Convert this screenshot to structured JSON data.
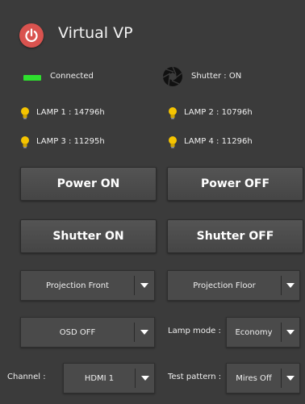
{
  "header": {
    "title": "Virtual VP"
  },
  "status": {
    "connection": "Connected",
    "shutter": "Shutter : ON",
    "led_color": "#2ee02e"
  },
  "lamps": [
    "LAMP 1 : 14796h",
    "LAMP 2 : 10796h",
    "LAMP 3 : 11295h",
    "LAMP 4 : 11296h"
  ],
  "buttons": {
    "power_on": "Power ON",
    "power_off": "Power OFF",
    "shutter_on": "Shutter ON",
    "shutter_off": "Shutter OFF"
  },
  "dropdowns": {
    "projection_mode": "Projection Front",
    "projection_orientation": "Projection Floor",
    "osd": "OSD OFF",
    "lamp_mode_label": "Lamp mode :",
    "lamp_mode": "Economy",
    "channel_label": "Channel :",
    "channel": "HDMI 1",
    "test_pattern_label": "Test pattern :",
    "test_pattern": "Mires Off"
  },
  "colors": {
    "background": "#3b3b3b",
    "power_icon_bg": "#d9534f",
    "bulb": "#f5c400"
  },
  "icons": {
    "power": "power-icon",
    "shutter": "aperture-icon",
    "lamp": "lightbulb-icon",
    "dropdown": "chevron-down-icon"
  }
}
